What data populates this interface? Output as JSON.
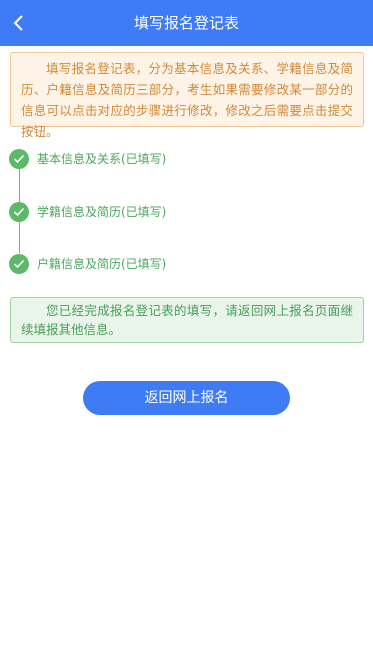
{
  "header": {
    "title": "填写报名登记表",
    "back_icon": "chevron-left-icon"
  },
  "notice": {
    "text": "填写报名登记表，分为基本信息及关系、学籍信息及简历、户籍信息及简历三部分，考生如果需要修改某一部分的信息可以点击对应的步骤进行修改，修改之后需要点击提交按钮。"
  },
  "steps": [
    {
      "label": "基本信息及关系(已填写)",
      "status": "done",
      "icon": "check-icon"
    },
    {
      "label": "学籍信息及简历(已填写)",
      "status": "done",
      "icon": "check-icon"
    },
    {
      "label": "户籍信息及简历(已填写)",
      "status": "done",
      "icon": "check-icon"
    }
  ],
  "success": {
    "text": "您已经完成报名登记表的填写，请返回网上报名页面继续填报其他信息。"
  },
  "return_button": {
    "label": "返回网上报名"
  },
  "colors": {
    "primary": "#3f7bf5",
    "notice_text": "#d08a3a",
    "notice_bg": "#fdf3e6",
    "success_text": "#4a9d58",
    "success_bg": "#e9f5ea",
    "step_check": "#5cb96a"
  }
}
